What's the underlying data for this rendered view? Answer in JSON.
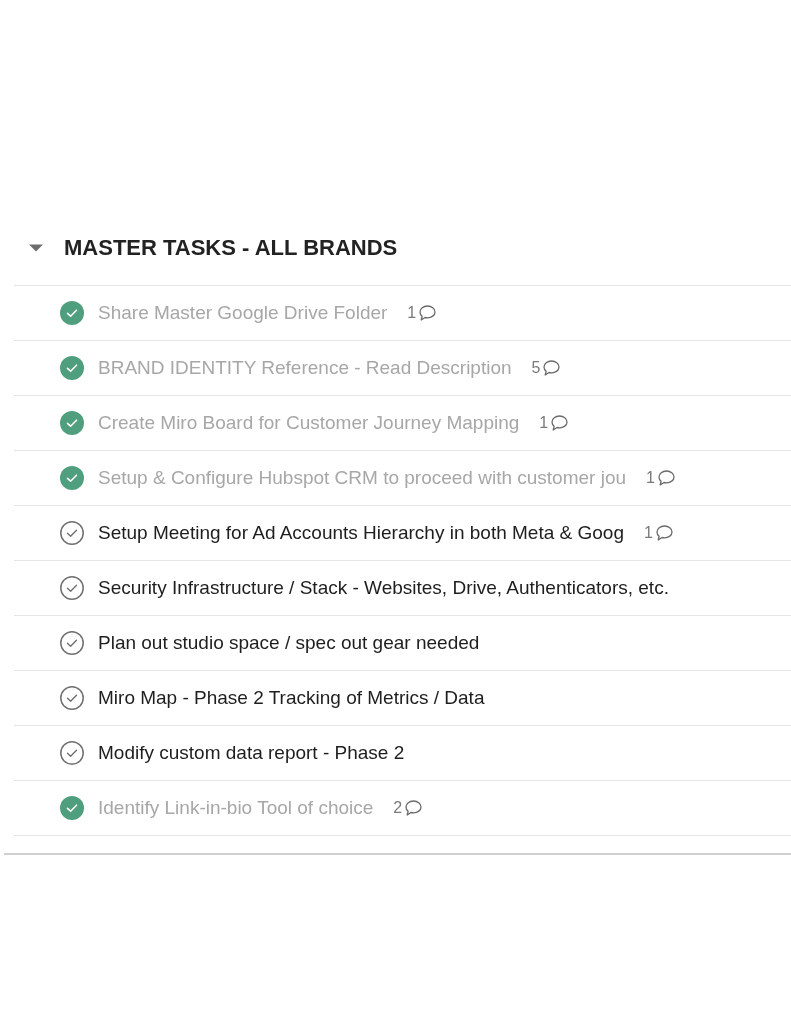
{
  "section": {
    "title": "MASTER TASKS - ALL BRANDS",
    "expanded": true
  },
  "tasks": [
    {
      "title": "Share Master Google Drive Folder",
      "completed": true,
      "comments": "1"
    },
    {
      "title": "BRAND IDENTITY Reference - Read Description",
      "completed": true,
      "comments": "5"
    },
    {
      "title": "Create Miro Board for Customer Journey Mapping",
      "completed": true,
      "comments": "1"
    },
    {
      "title": "Setup & Configure Hubspot CRM to proceed with customer jou",
      "completed": true,
      "comments": "1"
    },
    {
      "title": "Setup Meeting for Ad Accounts Hierarchy in both Meta & Goog",
      "completed": false,
      "comments": "1"
    },
    {
      "title": "Security Infrastructure / Stack - Websites, Drive, Authenticators, etc.",
      "completed": false
    },
    {
      "title": "Plan out studio space / spec out gear needed",
      "completed": false
    },
    {
      "title": "Miro Map - Phase 2 Tracking of Metrics / Data",
      "completed": false
    },
    {
      "title": "Modify custom data report - Phase 2",
      "completed": false
    },
    {
      "title": "Identify Link-in-bio Tool of choice",
      "completed": true,
      "comments": "2"
    }
  ]
}
